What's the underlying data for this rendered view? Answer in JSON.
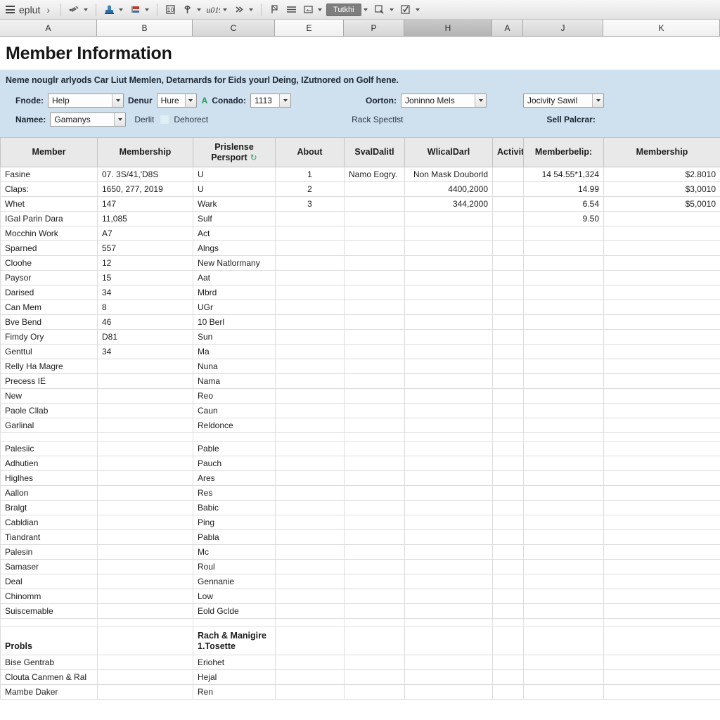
{
  "toolbar": {
    "app_name": "eplut",
    "chevron": "›",
    "active_button_label": "Tutkhi",
    "buttons": [
      {
        "name": "menu-icon",
        "label": ""
      },
      {
        "name": "paint-icon",
        "label": ""
      },
      {
        "name": "stamp-icon",
        "label": ""
      },
      {
        "name": "table-icon",
        "label": ""
      },
      {
        "name": "function-icon",
        "label": ""
      },
      {
        "name": "formula-icon",
        "label": ""
      },
      {
        "name": "chevrons-icon",
        "label": ""
      },
      {
        "name": "flag-icon",
        "label": ""
      },
      {
        "name": "lines-icon",
        "label": ""
      },
      {
        "name": "image-icon",
        "label": ""
      },
      {
        "name": "zoom-icon",
        "label": ""
      },
      {
        "name": "check-icon",
        "label": ""
      }
    ]
  },
  "columns": [
    {
      "letter": "A",
      "state": "sel"
    },
    {
      "letter": "B",
      "state": "lite"
    },
    {
      "letter": "C",
      "state": "normal"
    },
    {
      "letter": "E",
      "state": "lite"
    },
    {
      "letter": "P",
      "state": "normal"
    },
    {
      "letter": "H",
      "state": "dark"
    },
    {
      "letter": "A",
      "state": "normal"
    },
    {
      "letter": "J",
      "state": "normal"
    },
    {
      "letter": "K",
      "state": "lite"
    }
  ],
  "sheet": {
    "title": "Member Information",
    "description": "Neme nouglr arlyods Car Liut Memlen, Detarnards for Eids yourl Deing, IZutnored on Golf hene."
  },
  "form": {
    "row1": {
      "label_1": "Fnode:",
      "combo_1": "Help",
      "label_2": "Denur",
      "combo_2": "Hure",
      "green_marker": "A",
      "label_3": "Conado:",
      "combo_3": "1113",
      "label_4": "Oorton:",
      "combo_4": "Joninno Mels",
      "combo_5": "Jocivity Sawil"
    },
    "row2": {
      "label_1": "Namee:",
      "combo_1": "Gamanys",
      "label_2": "Derlit",
      "label_3": "Dehorect",
      "label_4": "Rack Spectlst",
      "label_5": "Sell Palcrar:"
    }
  },
  "table": {
    "headers": [
      "Member",
      "Membership",
      "Prislense Persport",
      "About",
      "SvalDalitl",
      "WlicalDarl",
      "Activity",
      "Memberbelip:",
      "Membership"
    ],
    "refresh_icon": "↻",
    "rows": [
      [
        "Fasine",
        "07. 3S/41,'D8S",
        "U",
        "1",
        "Namo Eogry.",
        "Non Mask Douborld",
        "",
        "14 54.55*1,324",
        "$2.8010"
      ],
      [
        "Claps:",
        "1650, 277, 2019",
        "U",
        "2",
        "",
        "4400,2000",
        "",
        "14.99",
        "$3,0010"
      ],
      [
        "Whet",
        "147",
        "Wark",
        "3",
        "",
        "344,2000",
        "",
        "6.54",
        "$5,0010"
      ],
      [
        "IGal Parin Dara",
        "11,085",
        "Sulf",
        "",
        "",
        "",
        "",
        "9.50",
        ""
      ],
      [
        "Mocchin Work",
        "A7",
        "Act",
        "",
        "",
        "",
        "",
        "",
        ""
      ],
      [
        "Sparned",
        "557",
        "Alngs",
        "",
        "",
        "",
        "",
        "",
        ""
      ],
      [
        "Cloohe",
        "12",
        "New Natlormany",
        "",
        "",
        "",
        "",
        "",
        ""
      ],
      [
        "Paysor",
        "15",
        "Aat",
        "",
        "",
        "",
        "",
        "",
        ""
      ],
      [
        "Darised",
        "34",
        "Mbrd",
        "",
        "",
        "",
        "",
        "",
        ""
      ],
      [
        "Can Mem",
        "8",
        "UGr",
        "",
        "",
        "",
        "",
        "",
        ""
      ],
      [
        "Bve Bend",
        "46",
        "10 Berl",
        "",
        "",
        "",
        "",
        "",
        ""
      ],
      [
        "Fimdy Ory",
        "D81",
        "Sun",
        "",
        "",
        "",
        "",
        "",
        ""
      ],
      [
        "Genttul",
        "34",
        "Ma",
        "",
        "",
        "",
        "",
        "",
        ""
      ],
      [
        "Relly Ha Magre",
        "",
        "Nuna",
        "",
        "",
        "",
        "",
        "",
        ""
      ],
      [
        "Precess IE",
        "",
        "Nama",
        "",
        "",
        "",
        "",
        "",
        ""
      ],
      [
        "New",
        "",
        "Reo",
        "",
        "",
        "",
        "",
        "",
        ""
      ],
      [
        "Paole Cllab",
        "",
        "Caun",
        "",
        "",
        "",
        "",
        "",
        ""
      ],
      [
        "Garlinal",
        "",
        "Reldonce",
        "",
        "",
        "",
        "",
        "",
        ""
      ]
    ],
    "rows2": [
      [
        "Palesiic",
        "",
        "Pable",
        "",
        "",
        "",
        "",
        "",
        ""
      ],
      [
        "Adhutien",
        "",
        "Pauch",
        "",
        "",
        "",
        "",
        "",
        ""
      ],
      [
        "Higlhes",
        "",
        "Ares",
        "",
        "",
        "",
        "",
        "",
        ""
      ],
      [
        "Aallon",
        "",
        "Res",
        "",
        "",
        "",
        "",
        "",
        ""
      ],
      [
        "Bralgt",
        "",
        "Babic",
        "",
        "",
        "",
        "",
        "",
        ""
      ],
      [
        "Cabldian",
        "",
        "Ping",
        "",
        "",
        "",
        "",
        "",
        ""
      ],
      [
        "Tiandrant",
        "",
        "Pabla",
        "",
        "",
        "",
        "",
        "",
        ""
      ],
      [
        "Palesin",
        "",
        "Mc",
        "",
        "",
        "",
        "",
        "",
        ""
      ],
      [
        "Samaser",
        "",
        "Roul",
        "",
        "",
        "",
        "",
        "",
        ""
      ],
      [
        "Deal",
        "",
        "Gennanie",
        "",
        "",
        "",
        "",
        "",
        ""
      ],
      [
        "Chinomm",
        "",
        "Low",
        "",
        "",
        "",
        "",
        "",
        ""
      ],
      [
        "Suiscemable",
        "",
        "Eold Gclde",
        "",
        "",
        "",
        "",
        "",
        ""
      ]
    ],
    "section": [
      "Probls",
      "",
      "Rach & Manigire 1.Tosette",
      "",
      "",
      "",
      "",
      "",
      ""
    ],
    "rows3": [
      [
        "Bise Gentrab",
        "",
        "Eriohet",
        "",
        "",
        "",
        "",
        "",
        ""
      ],
      [
        "Clouta Canmen & Ral",
        "",
        "Hejal",
        "",
        "",
        "",
        "",
        "",
        ""
      ],
      [
        "Mambe Daker",
        "",
        "Ren",
        "",
        "",
        "",
        "",
        "",
        ""
      ]
    ]
  }
}
